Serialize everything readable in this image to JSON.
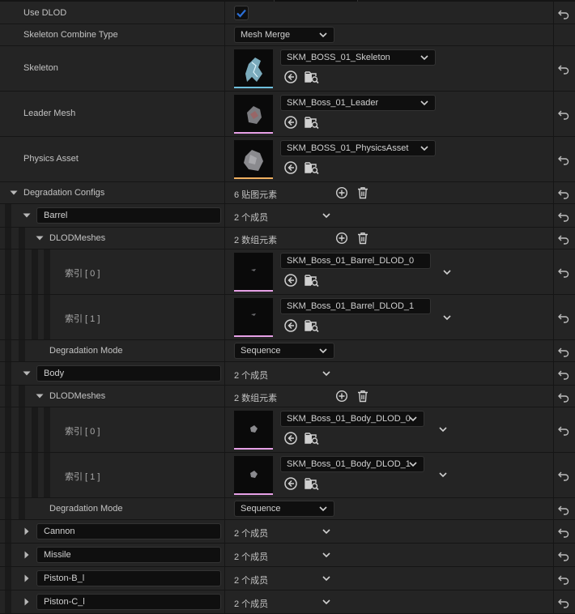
{
  "colors": {
    "accent": "#2b6fd6",
    "skeleton_bar": "#6fbfdc",
    "mesh_bar": "#e6a0e6",
    "physics_bar": "#f0b060"
  },
  "use_dlod": {
    "label": "Use DLOD",
    "checked": true
  },
  "skeleton_combine_type": {
    "label": "Skeleton Combine Type",
    "value": "Mesh Merge"
  },
  "skeleton": {
    "label": "Skeleton",
    "asset": "SKM_BOSS_01_Skeleton"
  },
  "leader_mesh": {
    "label": "Leader Mesh",
    "asset": "SKM_Boss_01_Leader"
  },
  "physics_asset": {
    "label": "Physics Asset",
    "asset": "SKM_BOSS_01_PhysicsAsset"
  },
  "degradation_configs": {
    "label": "Degradation Configs",
    "count_text": "6 贴图元素",
    "groups": [
      {
        "key": "Barrel",
        "members": "2 个成员",
        "dlod_label": "DLODMeshes",
        "dlod_count": "2 数组元素",
        "items": [
          {
            "index_label": "索引 [ 0 ]",
            "asset": "SKM_Boss_01_Barrel_DLOD_0"
          },
          {
            "index_label": "索引 [ 1 ]",
            "asset": "SKM_Boss_01_Barrel_DLOD_1"
          }
        ],
        "mode_label": "Degradation Mode",
        "mode_value": "Sequence"
      },
      {
        "key": "Body",
        "members": "2 个成员",
        "dlod_label": "DLODMeshes",
        "dlod_count": "2 数组元素",
        "items": [
          {
            "index_label": "索引 [ 0 ]",
            "asset": "SKM_Boss_01_Body_DLOD_0"
          },
          {
            "index_label": "索引 [ 1 ]",
            "asset": "SKM_Boss_01_Body_DLOD_1"
          }
        ],
        "mode_label": "Degradation Mode",
        "mode_value": "Sequence"
      }
    ],
    "collapsed": [
      {
        "key": "Cannon",
        "members": "2 个成员"
      },
      {
        "key": "Missile",
        "members": "2 个成员"
      },
      {
        "key": "Piston-B_l",
        "members": "2 个成员"
      },
      {
        "key": "Piston-C_l",
        "members": "2 个成员"
      }
    ]
  }
}
